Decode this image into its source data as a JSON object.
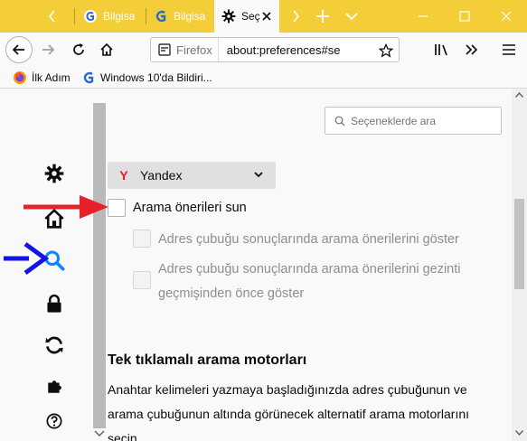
{
  "tabs": [
    {
      "title": "Bilgisa",
      "active": false
    },
    {
      "title": "Bilgisa",
      "active": false
    },
    {
      "title": "Seç",
      "active": true
    }
  ],
  "urlbar": {
    "identity_label": "Firefox",
    "url": "about:preferences#se"
  },
  "bookmarks": [
    {
      "label": "İlk Adım"
    },
    {
      "label": "Windows 10'da Bildiri..."
    }
  ],
  "sidebar": {
    "categories": [
      {
        "name": "general",
        "icon": "gear-icon"
      },
      {
        "name": "home",
        "icon": "home-icon"
      },
      {
        "name": "search",
        "icon": "search-icon",
        "selected": true
      },
      {
        "name": "privacy",
        "icon": "lock-icon"
      },
      {
        "name": "sync",
        "icon": "sync-icon"
      },
      {
        "name": "extensions",
        "icon": "puzzle-icon"
      },
      {
        "name": "support",
        "icon": "help-icon"
      }
    ]
  },
  "search_prefs": {
    "placeholder": "Seçeneklerde ara"
  },
  "engine": {
    "selected": "Yandex"
  },
  "suggestions": {
    "main_label": "Arama önerileri sun",
    "main_checked": false,
    "sub1_label": "Adres çubuğu sonuçlarında arama önerilerini göster",
    "sub2_line1": "Adres çubuğu sonuçlarında arama önerilerini gezinti",
    "sub2_line2": "geçmişinden önce göster"
  },
  "one_click": {
    "title": "Tek tıklamalı arama motorları",
    "desc_line1": "Anahtar kelimeleri yazmaya başladığınızda adres çubuğunun ve",
    "desc_line2": "arama çubuğunun altında görünecek alternatif arama motorlarını",
    "desc_line3": "seçin."
  },
  "colors": {
    "tabstrip": "#f4ce38",
    "annotation_red": "#e8202a",
    "annotation_blue": "#1414e6"
  }
}
